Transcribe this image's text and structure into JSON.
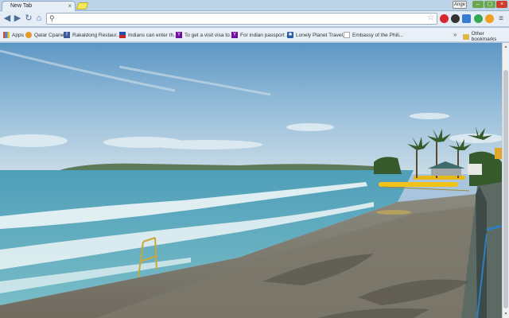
{
  "tab": {
    "title": "New Tab",
    "close": "×"
  },
  "window": {
    "user": "Ange",
    "min": "–",
    "max": "▢",
    "close": "×"
  },
  "toolbar": {
    "back": "◀",
    "forward": "▶",
    "reload": "↻",
    "home": "⌂",
    "omnibox_value": "",
    "star": "☆"
  },
  "bookmarks": [
    {
      "label": "Apps",
      "color": "#d04e3c"
    },
    {
      "label": "Qatar Cpanel",
      "color": "#e59a2d"
    },
    {
      "label": "Rakaldong Restaur...",
      "color": "#3b5998"
    },
    {
      "label": "Indians can enter th...",
      "color": "#c8262a"
    },
    {
      "label": "To get a visit visa to...",
      "color": "#720e9e"
    },
    {
      "label": "For indian passport ...",
      "color": "#720e9e"
    },
    {
      "label": "Lonely Planet Travel...",
      "color": "#2b5ea7"
    },
    {
      "label": "Embassy of the Phili...",
      "color": "#aaaaaa"
    }
  ],
  "bookmarks_more": "»",
  "other_bookmarks": "Other bookmarks"
}
